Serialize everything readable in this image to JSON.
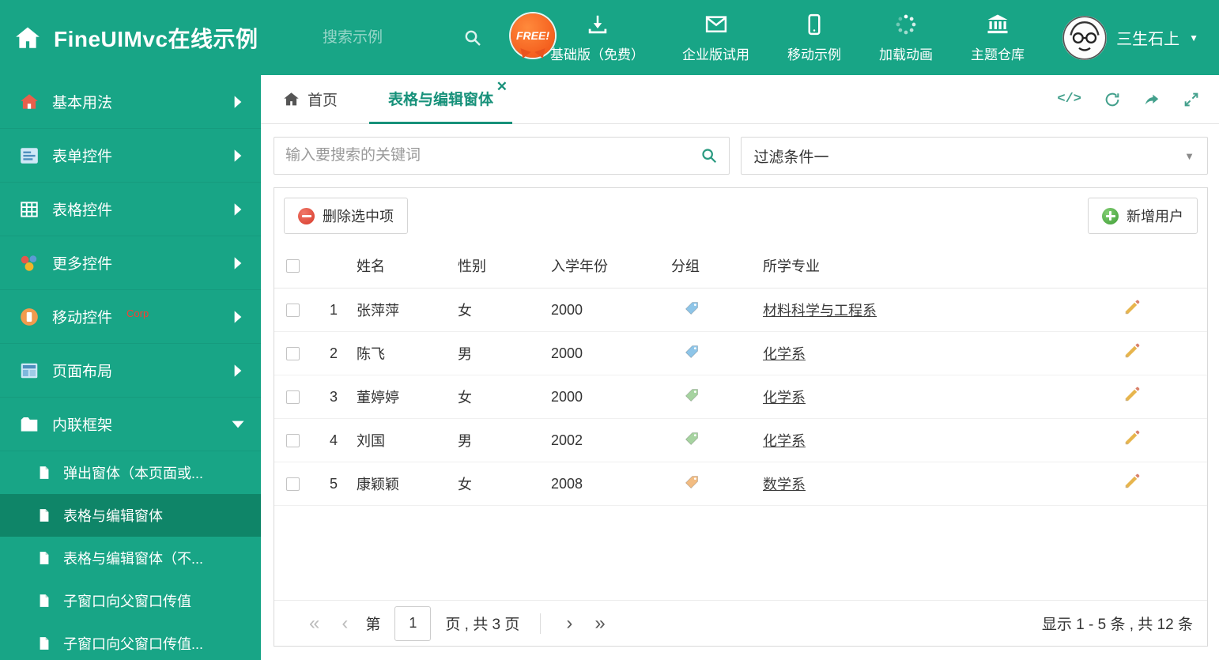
{
  "header": {
    "title": "FineUIMvc在线示例",
    "search_placeholder": "搜索示例",
    "free_badge": "FREE!",
    "nav": [
      {
        "label": "基础版（免费）",
        "icon": "download-icon"
      },
      {
        "label": "企业版试用",
        "icon": "envelope-icon"
      },
      {
        "label": "移动示例",
        "icon": "mobile-icon"
      },
      {
        "label": "加载动画",
        "icon": "spinner-icon"
      },
      {
        "label": "主题仓库",
        "icon": "bank-icon"
      }
    ],
    "user_name": "三生石上"
  },
  "sidebar": {
    "items": [
      {
        "label": "基本用法",
        "icon": "home-icon"
      },
      {
        "label": "表单控件",
        "icon": "form-icon"
      },
      {
        "label": "表格控件",
        "icon": "table-icon"
      },
      {
        "label": "更多控件",
        "icon": "widgets-icon"
      },
      {
        "label": "移动控件",
        "icon": "mobile-circle-icon",
        "badge": "Corp"
      },
      {
        "label": "页面布局",
        "icon": "layout-icon"
      },
      {
        "label": "内联框架",
        "icon": "folder-icon"
      }
    ],
    "subitems": [
      {
        "label": "弹出窗体（本页面或..."
      },
      {
        "label": "表格与编辑窗体"
      },
      {
        "label": "表格与编辑窗体（不..."
      },
      {
        "label": "子窗口向父窗口传值"
      },
      {
        "label": "子窗口向父窗口传值..."
      }
    ]
  },
  "tabs": {
    "home": "首页",
    "active": "表格与编辑窗体"
  },
  "filters": {
    "search_placeholder": "输入要搜索的关键词",
    "filter_value": "过滤条件一"
  },
  "toolbar": {
    "delete_label": "删除选中项",
    "add_label": "新增用户"
  },
  "table": {
    "headers": {
      "name": "姓名",
      "gender": "性别",
      "year": "入学年份",
      "group": "分组",
      "major": "所学专业"
    },
    "rows": [
      {
        "index": "1",
        "name": "张萍萍",
        "gender": "女",
        "year": "2000",
        "major": "材料科学与工程系",
        "tag_color": "#8ec5e8"
      },
      {
        "index": "2",
        "name": "陈飞",
        "gender": "男",
        "year": "2000",
        "major": "化学系",
        "tag_color": "#8ec5e8"
      },
      {
        "index": "3",
        "name": "董婷婷",
        "gender": "女",
        "year": "2000",
        "major": "化学系",
        "tag_color": "#a6d3a0"
      },
      {
        "index": "4",
        "name": "刘国",
        "gender": "男",
        "year": "2002",
        "major": "化学系",
        "tag_color": "#a6d3a0"
      },
      {
        "index": "5",
        "name": "康颖颖",
        "gender": "女",
        "year": "2008",
        "major": "数学系",
        "tag_color": "#f2bc82"
      }
    ]
  },
  "pagination": {
    "prefix": "第",
    "page_value": "1",
    "suffix": "页 , 共 3 页",
    "summary": "显示 1 - 5 条 , 共 12 条"
  },
  "colors": {
    "theme": "#18a586",
    "active_item": "#0f8568",
    "danger": "#d83a2b",
    "success": "#3f9e36",
    "link_underline": "#3c3c3c"
  }
}
